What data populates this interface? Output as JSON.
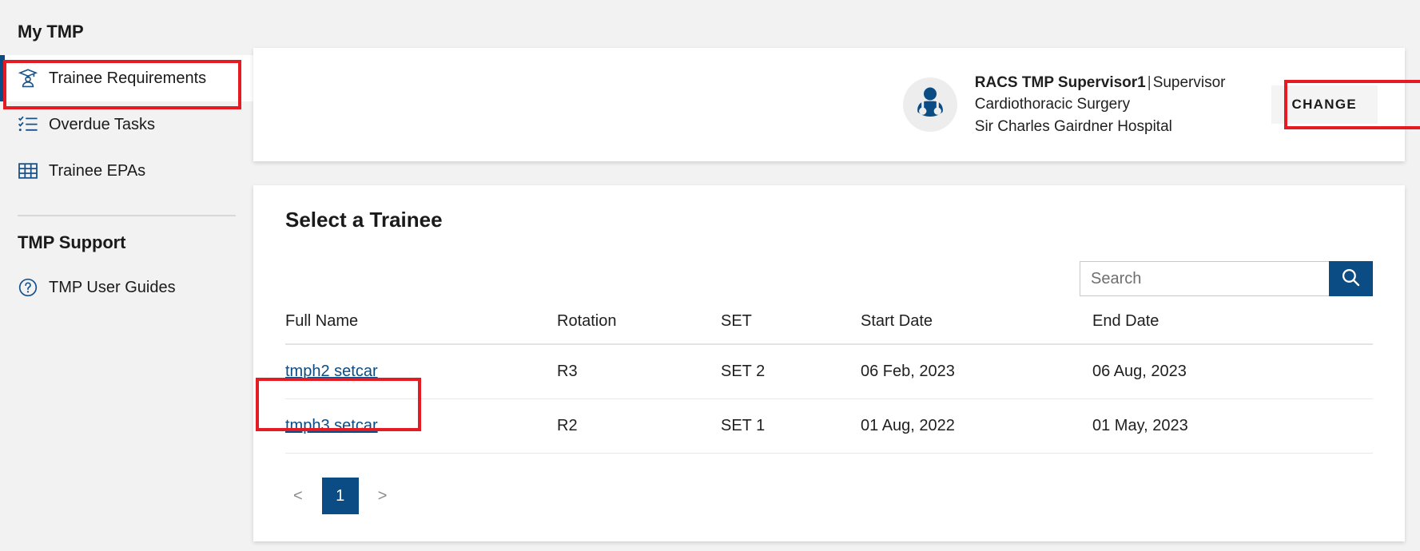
{
  "sidebar": {
    "my_tmp_heading": "My TMP",
    "nav_items": [
      {
        "label": "Trainee Requirements",
        "icon": "graduation-user-icon",
        "active": true
      },
      {
        "label": "Overdue Tasks",
        "icon": "checklist-icon",
        "active": false
      },
      {
        "label": "Trainee EPAs",
        "icon": "table-grid-icon",
        "active": false
      }
    ],
    "support_heading": "TMP Support",
    "support_items": [
      {
        "label": "TMP User Guides",
        "icon": "question-circle-icon"
      }
    ]
  },
  "header": {
    "avatar_icon": "doctor-avatar-icon",
    "user_name": "RACS TMP Supervisor1",
    "separator": "|",
    "user_role": "Supervisor",
    "specialty": "Cardiothoracic Surgery",
    "hospital": "Sir Charles Gairdner Hospital",
    "change_button": "CHANGE"
  },
  "trainee_panel": {
    "title": "Select a Trainee",
    "search": {
      "placeholder": "Search",
      "value": "",
      "button_icon": "search-icon"
    },
    "table": {
      "columns": [
        "Full Name",
        "Rotation",
        "SET",
        "Start Date",
        "End Date"
      ],
      "rows": [
        {
          "full_name": "tmph2 setcar",
          "rotation": "R3",
          "set": "SET 2",
          "start_date": "06 Feb, 2023",
          "end_date": "06 Aug, 2023"
        },
        {
          "full_name": "tmph3 setcar",
          "rotation": "R2",
          "set": "SET 1",
          "start_date": "01 Aug, 2022",
          "end_date": "01 May, 2023"
        }
      ]
    },
    "pagination": {
      "prev": "<",
      "pages": [
        "1"
      ],
      "next": ">",
      "current": "1"
    }
  },
  "colors": {
    "brand_blue": "#0b4c84",
    "icon_blue": "#17538a",
    "annotation_red": "#e51b23",
    "page_bg": "#f2f2f2",
    "card_bg": "#ffffff"
  }
}
